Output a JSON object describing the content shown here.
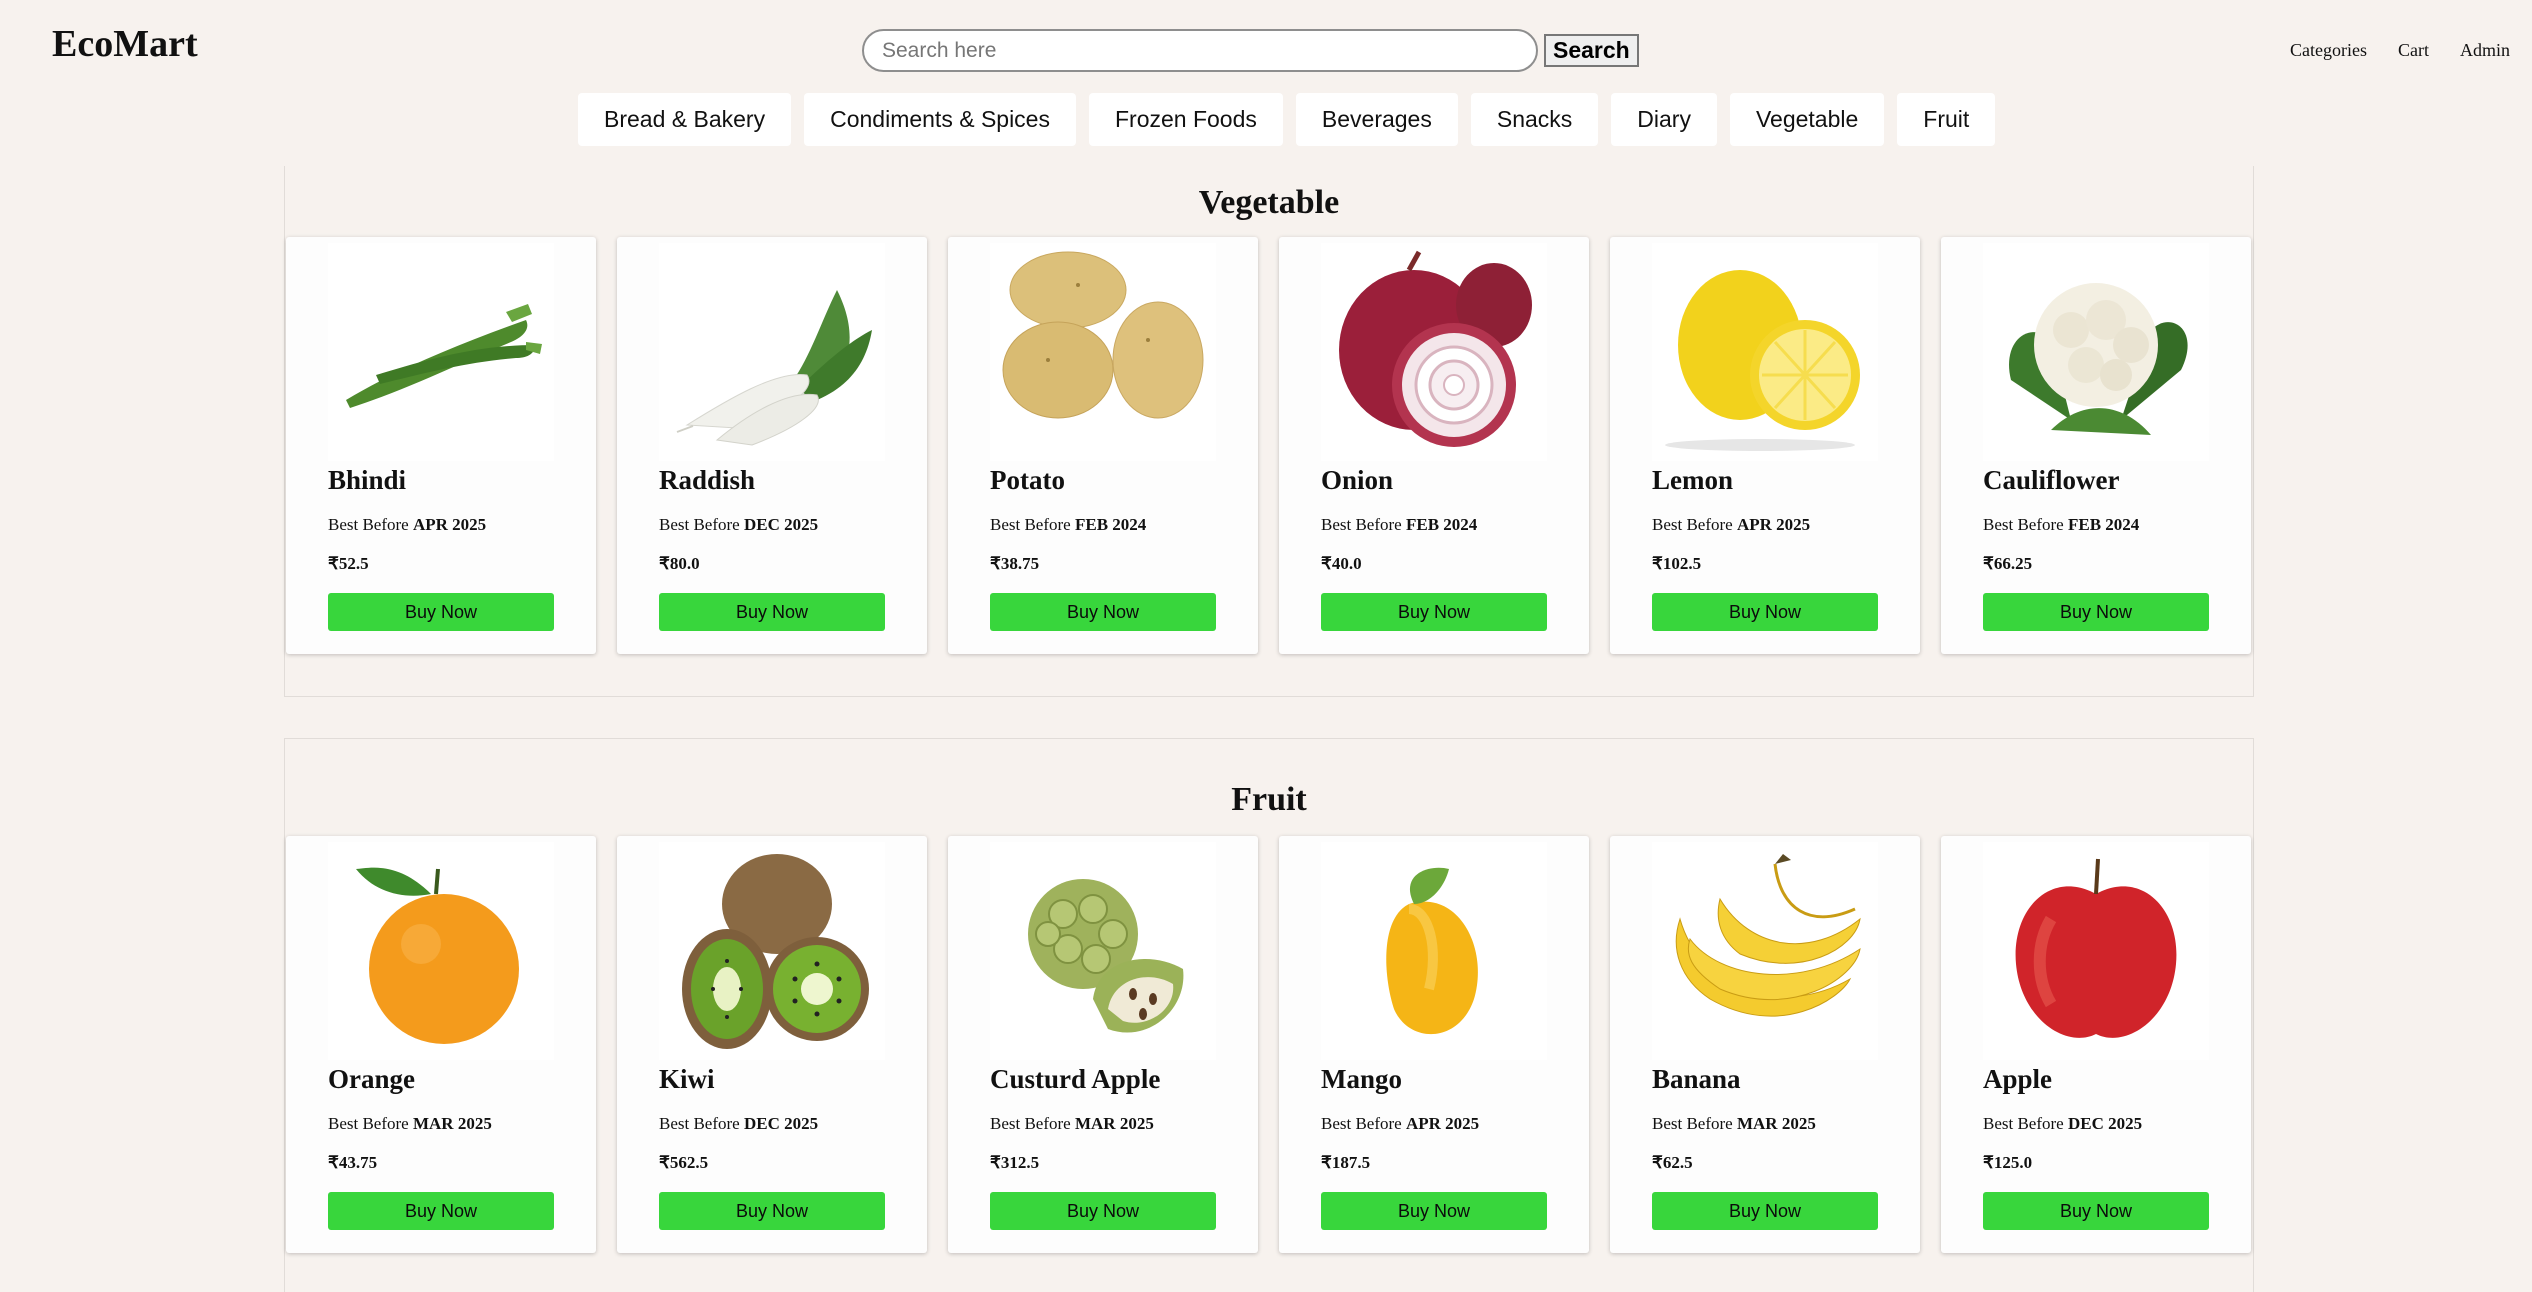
{
  "brand": "EcoMart",
  "search": {
    "placeholder": "Search here",
    "value": "",
    "button": "Search"
  },
  "topnav": [
    "Categories",
    "Cart",
    "Admin"
  ],
  "categories": [
    "Bread & Bakery",
    "Condiments & Spices",
    "Frozen Foods",
    "Beverages",
    "Snacks",
    "Diary",
    "Vegetable",
    "Fruit"
  ],
  "colors": {
    "background": "#f7f2ee",
    "buy_button": "#38d63c"
  },
  "best_before_label": "Best Before",
  "buy_label": "Buy Now",
  "sections": [
    {
      "title": "Vegetable",
      "products": [
        {
          "name": "Bhindi",
          "best_before": "APR 2025",
          "price": "₹52.5",
          "icon": "okra-icon"
        },
        {
          "name": "Raddish",
          "best_before": "DEC 2025",
          "price": "₹80.0",
          "icon": "radish-icon"
        },
        {
          "name": "Potato",
          "best_before": "FEB 2024",
          "price": "₹38.75",
          "icon": "potato-icon"
        },
        {
          "name": "Onion",
          "best_before": "FEB 2024",
          "price": "₹40.0",
          "icon": "onion-icon"
        },
        {
          "name": "Lemon",
          "best_before": "APR 2025",
          "price": "₹102.5",
          "icon": "lemon-icon"
        },
        {
          "name": "Cauliflower",
          "best_before": "FEB 2024",
          "price": "₹66.25",
          "icon": "cauliflower-icon"
        }
      ]
    },
    {
      "title": "Fruit",
      "products": [
        {
          "name": "Orange",
          "best_before": "MAR 2025",
          "price": "₹43.75",
          "icon": "orange-icon"
        },
        {
          "name": "Kiwi",
          "best_before": "DEC 2025",
          "price": "₹562.5",
          "icon": "kiwi-icon"
        },
        {
          "name": "Custurd Apple",
          "best_before": "MAR 2025",
          "price": "₹312.5",
          "icon": "custard-apple-icon"
        },
        {
          "name": "Mango",
          "best_before": "APR 2025",
          "price": "₹187.5",
          "icon": "mango-icon"
        },
        {
          "name": "Banana",
          "best_before": "MAR 2025",
          "price": "₹62.5",
          "icon": "banana-icon"
        },
        {
          "name": "Apple",
          "best_before": "DEC 2025",
          "price": "₹125.0",
          "icon": "apple-icon"
        }
      ]
    }
  ]
}
